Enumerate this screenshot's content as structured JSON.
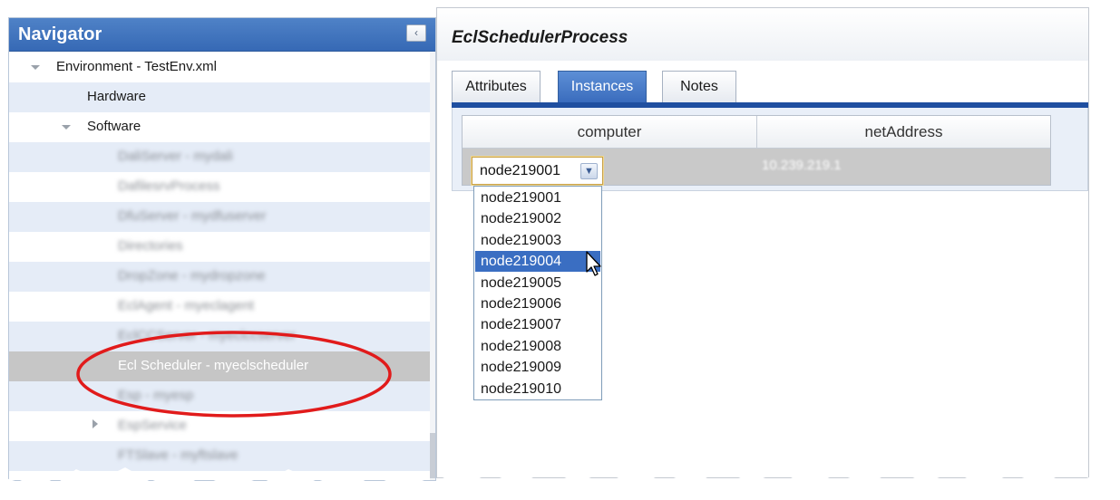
{
  "navigator": {
    "title": "Navigator",
    "collapse_glyph": "‹",
    "tree": [
      {
        "label": "Environment - TestEnv.xml",
        "level": 0,
        "twisty": "expanded",
        "blurred": false
      },
      {
        "label": "Hardware",
        "level": 1,
        "twisty": "none",
        "blurred": false
      },
      {
        "label": "Software",
        "level": 1,
        "twisty": "expanded",
        "blurred": false
      },
      {
        "label": "DaliServer - mydali",
        "level": 2,
        "twisty": "none",
        "blurred": true
      },
      {
        "label": "DafilesrvProcess",
        "level": 2,
        "twisty": "none",
        "blurred": true
      },
      {
        "label": "DfuServer - mydfuserver",
        "level": 2,
        "twisty": "none",
        "blurred": true
      },
      {
        "label": "Directories",
        "level": 2,
        "twisty": "none",
        "blurred": true
      },
      {
        "label": "DropZone - mydropzone",
        "level": 2,
        "twisty": "none",
        "blurred": true
      },
      {
        "label": "EclAgent - myeclagent",
        "level": 2,
        "twisty": "none",
        "blurred": true
      },
      {
        "label": "EclCCServer - myeclccserver",
        "level": 2,
        "twisty": "none",
        "blurred": true
      },
      {
        "label": "Ecl Scheduler - myeclscheduler",
        "level": 2,
        "twisty": "none",
        "blurred": false,
        "selected": true
      },
      {
        "label": "Esp - myesp",
        "level": 2,
        "twisty": "none",
        "blurred": true
      },
      {
        "label": "EspService",
        "level": 2,
        "twisty": "collapsed",
        "blurred": true
      },
      {
        "label": "FTSlave - myftslave",
        "level": 2,
        "twisty": "none",
        "blurred": true
      }
    ]
  },
  "process": {
    "title": "EclSchedulerProcess",
    "tabs": [
      {
        "label": "Attributes",
        "active": false
      },
      {
        "label": "Instances",
        "active": true
      },
      {
        "label": "Notes",
        "active": false
      }
    ]
  },
  "grid": {
    "columns": [
      "computer",
      "netAddress"
    ],
    "row": {
      "computer": "node219001",
      "netAddress": "10.239.219.1"
    }
  },
  "dropdown": {
    "selected_value": "node219001",
    "highlighted": "node219004",
    "options": [
      "node219001",
      "node219002",
      "node219003",
      "node219004",
      "node219005",
      "node219006",
      "node219007",
      "node219008",
      "node219009",
      "node219010"
    ]
  },
  "icons": {
    "tree_expanded": "triangle-down-icon",
    "tree_collapsed": "triangle-right-icon",
    "combo_arrow": "chevron-down-icon",
    "cursor": "mouse-pointer-icon"
  },
  "colors": {
    "navigator_header": "#3d71bb",
    "active_tab": "#3a6cbd",
    "highlight": "#3a6ec2",
    "annotation": "#e11b1b"
  }
}
